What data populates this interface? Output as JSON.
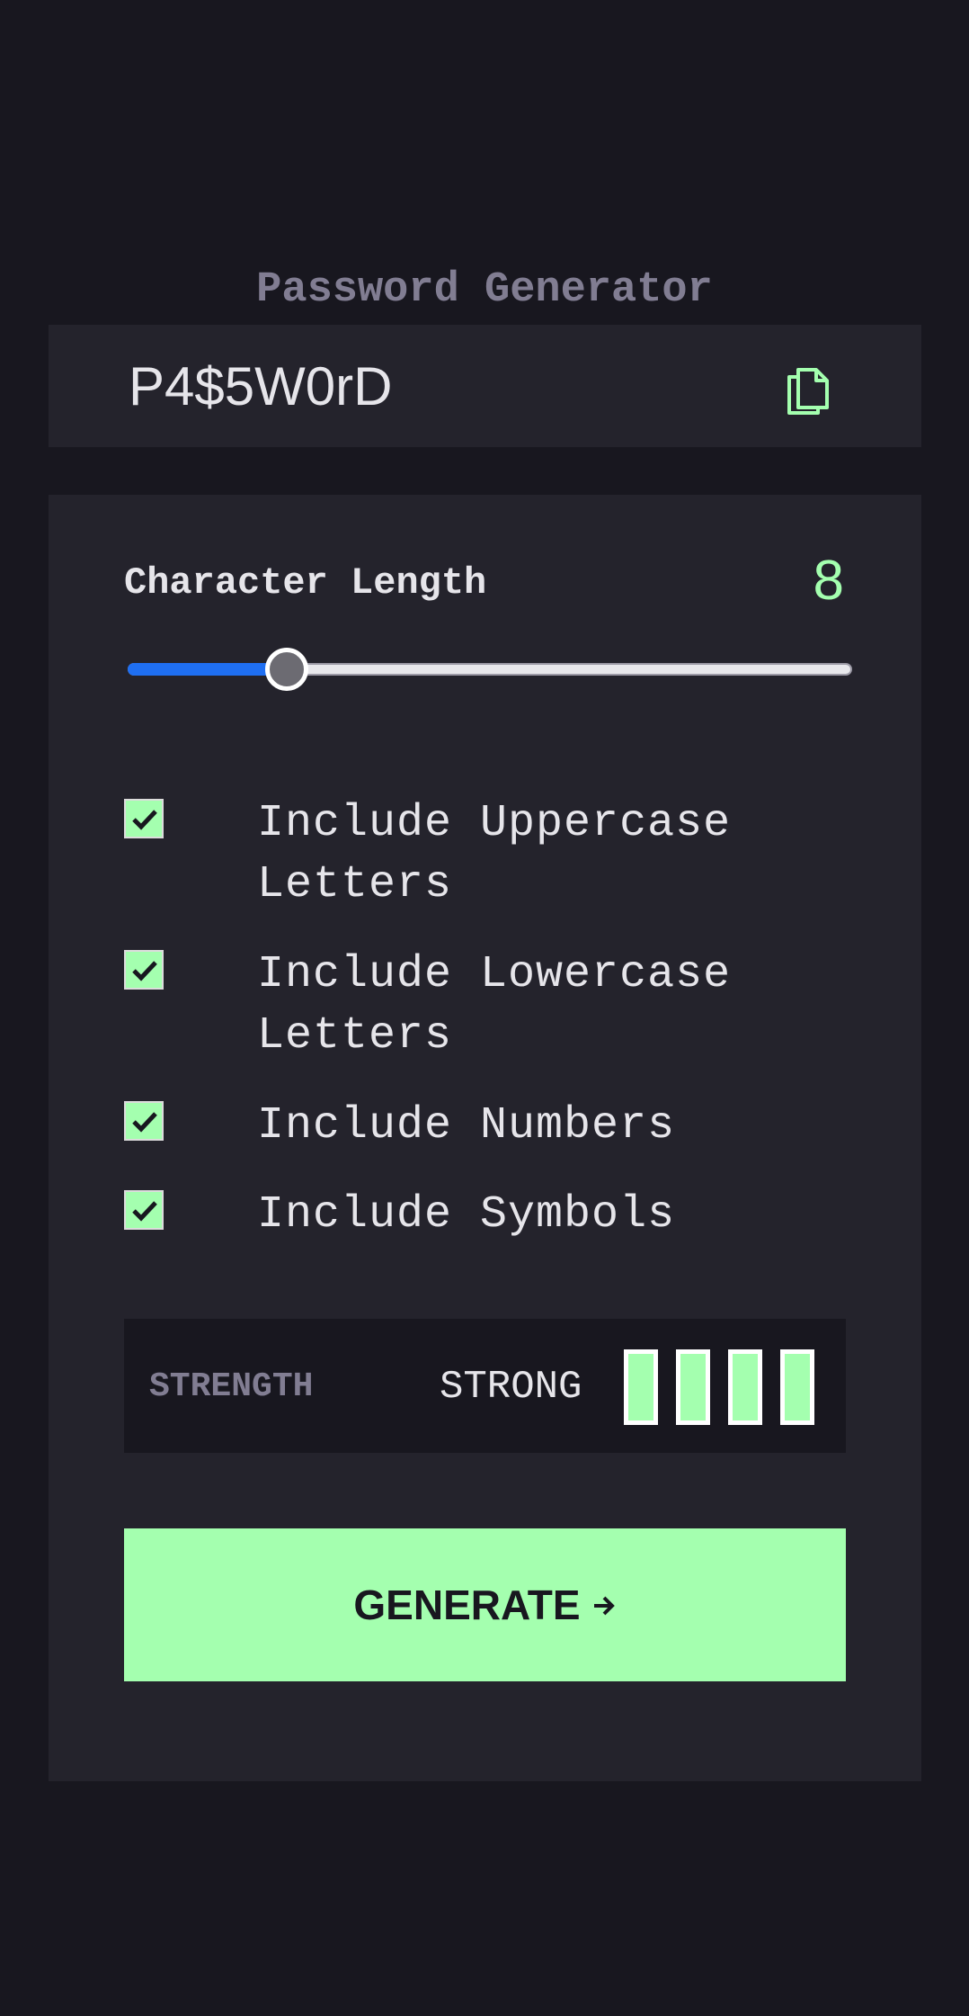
{
  "app": {
    "title": "Password Generator"
  },
  "password": {
    "value": "P4$5W0rD",
    "copy_icon": "copy-icon"
  },
  "length": {
    "label": "Character Length",
    "value": "8",
    "slider_fraction": 0.22
  },
  "options": [
    {
      "label": "Include Uppercase Letters",
      "checked": true
    },
    {
      "label": "Include Lowercase Letters",
      "checked": true
    },
    {
      "label": "Include Numbers",
      "checked": true
    },
    {
      "label": "Include Symbols",
      "checked": true
    }
  ],
  "strength": {
    "label": "STRENGTH",
    "value": "STRONG",
    "level": 4,
    "max_level": 4
  },
  "generate": {
    "label": "GENERATE",
    "icon": "arrow-right-icon"
  },
  "colors": {
    "accent": "#a4ffaf",
    "background": "#18171f",
    "surface": "#24232c",
    "muted": "#817d92",
    "slider_fill": "#1f6ff2"
  }
}
